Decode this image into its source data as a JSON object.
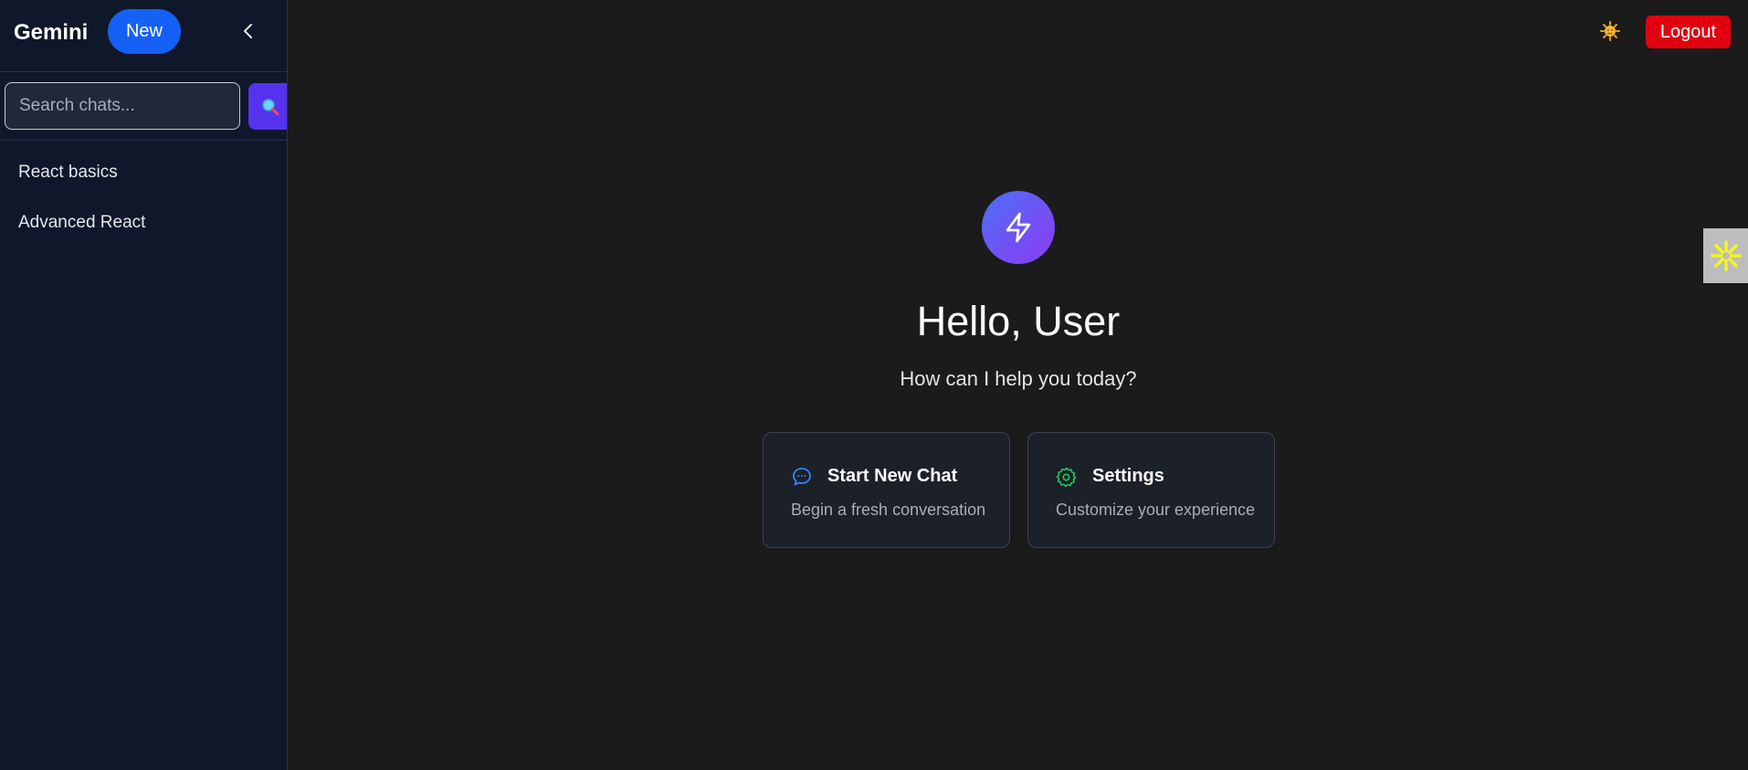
{
  "app": {
    "title": "Gemini",
    "new_label": "New"
  },
  "search": {
    "placeholder": "Search chats...",
    "value": ""
  },
  "chats": [
    {
      "label": "React basics"
    },
    {
      "label": "Advanced React"
    }
  ],
  "topbar": {
    "logout_label": "Logout"
  },
  "main": {
    "greeting": "Hello, User",
    "subtitle": "How can I help you today?",
    "cards": [
      {
        "title": "Start New Chat",
        "description": "Begin a fresh conversation",
        "icon": "chat-bubble-icon"
      },
      {
        "title": "Settings",
        "description": "Customize your experience",
        "icon": "gear-icon"
      }
    ]
  },
  "colors": {
    "sidebar_bg": "#0f172a",
    "main_bg": "#1b1b1c",
    "new_button": "#1561f5",
    "search_button": "#5533ee",
    "logout_button": "#e1000f",
    "logo_gradient_start": "#4f6ef7",
    "logo_gradient_end": "#8a3cf2",
    "chat_icon": "#3b82f6",
    "settings_icon": "#22c55e"
  }
}
